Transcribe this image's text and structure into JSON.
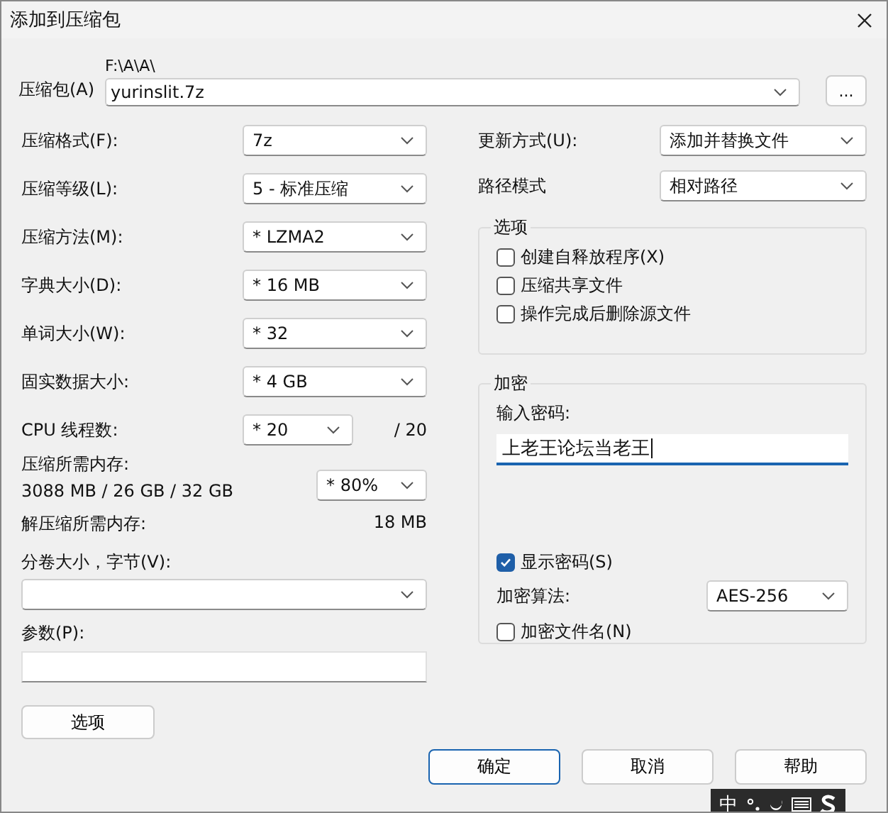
{
  "window": {
    "title": "添加到压缩包"
  },
  "archive": {
    "label": "压缩包(A)",
    "path": "F:\\A\\A\\",
    "value": "yurinslit.7z",
    "browse": "..."
  },
  "left_fields": [
    {
      "kind": "combo",
      "label": "压缩格式(F):",
      "value": "7z"
    },
    {
      "kind": "combo",
      "label": "压缩等级(L):",
      "value": "5 - 标准压缩"
    },
    {
      "kind": "combo",
      "label": "压缩方法(M):",
      "value": "*  LZMA2"
    },
    {
      "kind": "combo",
      "label": "字典大小(D):",
      "value": "*  16 MB"
    },
    {
      "kind": "combo",
      "label": "单词大小(W):",
      "value": "*  32"
    },
    {
      "kind": "combo",
      "label": "固实数据大小:",
      "value": "*  4 GB"
    },
    {
      "kind": "cpu",
      "label": "CPU 线程数:",
      "value": "*  20",
      "suffix": "/ 20"
    },
    {
      "kind": "memory",
      "label": "压缩所需内存:",
      "detail": "3088 MB / 26 GB / 32 GB",
      "value": "* 80%"
    },
    {
      "kind": "info",
      "label": "解压缩所需内存:",
      "value": "18 MB"
    }
  ],
  "volume": {
    "label": "分卷大小，字节(V):"
  },
  "parameters": {
    "label": "参数(P):"
  },
  "options_button": "选项",
  "update_mode": {
    "label": "更新方式(U):",
    "value": "添加并替换文件"
  },
  "path_mode": {
    "label": "路径模式",
    "value": "相对路径"
  },
  "options_group": {
    "title": "选项",
    "checkboxes": [
      {
        "label": "创建自释放程序(X)",
        "checked": false
      },
      {
        "label": "压缩共享文件",
        "checked": false
      },
      {
        "label": "操作完成后删除源文件",
        "checked": false
      }
    ]
  },
  "encryption": {
    "title": "加密",
    "password_label": "输入密码:",
    "password": "上老王论坛当老王",
    "show_password": {
      "label": "显示密码(S)",
      "checked": true
    },
    "method_label": "加密算法:",
    "method": "AES-256",
    "encrypt_names": {
      "label": "加密文件名(N)",
      "checked": false
    }
  },
  "buttons": [
    {
      "label": "确定",
      "default": true
    },
    {
      "label": "取消",
      "default": false
    },
    {
      "label": "帮助",
      "default": false
    }
  ],
  "ime_bar": {
    "mode": "中"
  }
}
